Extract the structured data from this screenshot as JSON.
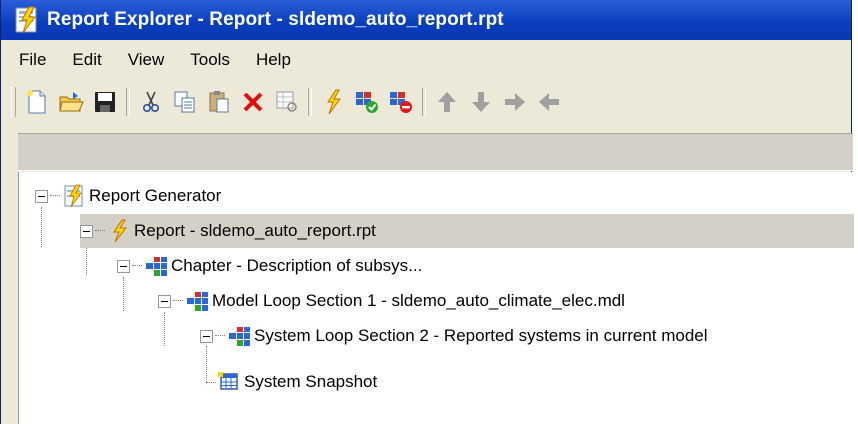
{
  "window": {
    "title": "Report Explorer - Report - sldemo_auto_report.rpt"
  },
  "menu": [
    "File",
    "Edit",
    "View",
    "Tools",
    "Help"
  ],
  "toolbar": {
    "buttons": [
      "new-icon",
      "open-icon",
      "save-icon",
      "cut-icon",
      "copy-icon",
      "paste-icon",
      "delete-icon",
      "properties-icon",
      "generate-report-icon",
      "activate-icon",
      "deactivate-icon",
      "move-up-icon",
      "move-down-icon",
      "demote-icon",
      "promote-icon"
    ]
  },
  "tree": {
    "nodes": [
      {
        "label": "Report Generator",
        "icon": "report-generator-icon"
      },
      {
        "label": "Report - sldemo_auto_report.rpt",
        "icon": "report-icon",
        "selected": true
      },
      {
        "label": "Chapter - Description of subsys...",
        "icon": "component-icon"
      },
      {
        "label": "Model Loop Section 1 - sldemo_auto_climate_elec.mdl",
        "icon": "component-icon"
      },
      {
        "label": "System Loop Section 2 - Reported systems in current model",
        "icon": "component-icon"
      },
      {
        "label": "System Snapshot",
        "icon": "snapshot-icon"
      }
    ]
  },
  "colors": {
    "titlebar": "#0a3fbf",
    "background": "#ece9d8",
    "selection": "#d4d0c8"
  }
}
